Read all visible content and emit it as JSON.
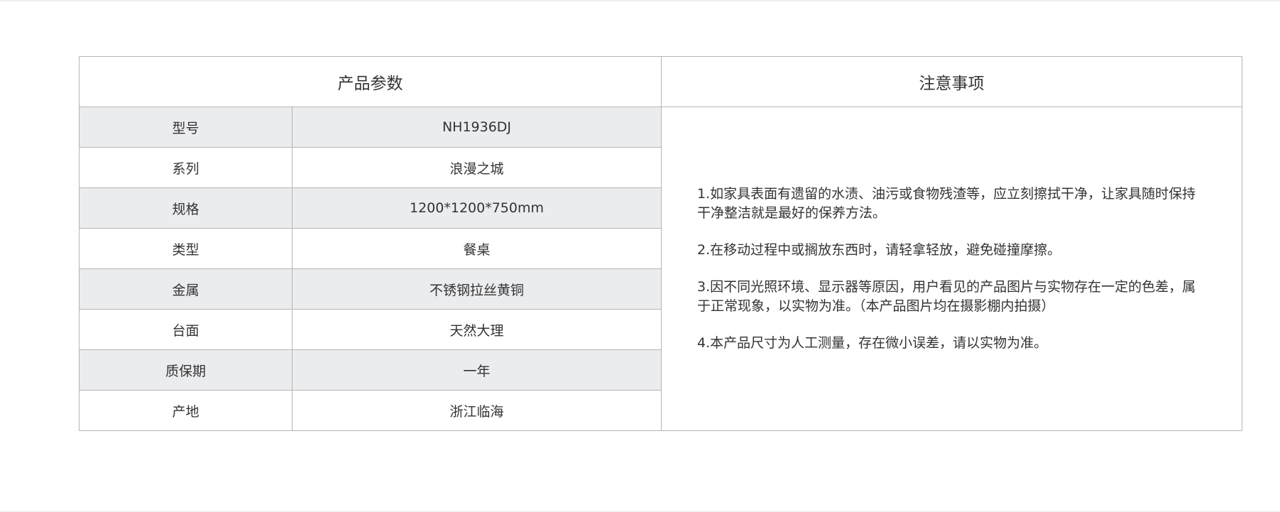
{
  "table": {
    "params_header": "产品参数",
    "notes_header": "注意事项",
    "rows": [
      {
        "label": "型号",
        "value": "NH1936DJ"
      },
      {
        "label": "系列",
        "value": "浪漫之城"
      },
      {
        "label": "规格",
        "value": "1200*1200*750mm"
      },
      {
        "label": "类型",
        "value": "餐桌"
      },
      {
        "label": "金属",
        "value": "不锈钢拉丝黄铜"
      },
      {
        "label": "台面",
        "value": "天然大理"
      },
      {
        "label": "质保期",
        "value": "一年"
      },
      {
        "label": "产地",
        "value": "浙江临海"
      }
    ],
    "notes": [
      "1.如家具表面有遗留的水渍、油污或食物残渣等，应立刻擦拭干净，让家具随时保持干净整洁就是最好的保养方法。",
      "2.在移动过程中或搁放东西时，请轻拿轻放，避免碰撞摩擦。",
      "3.因不同光照环境、显示器等原因，用户看见的产品图片与实物存在一定的色差，属于正常现象，以实物为准。（本产品图片均在摄影棚内拍摄）",
      "4.本产品尺寸为人工测量，存在微小误差，请以实物为准。"
    ]
  },
  "colors": {
    "shaded_row": "#ebecee",
    "border": "#b5b5b5",
    "text": "#333333"
  }
}
